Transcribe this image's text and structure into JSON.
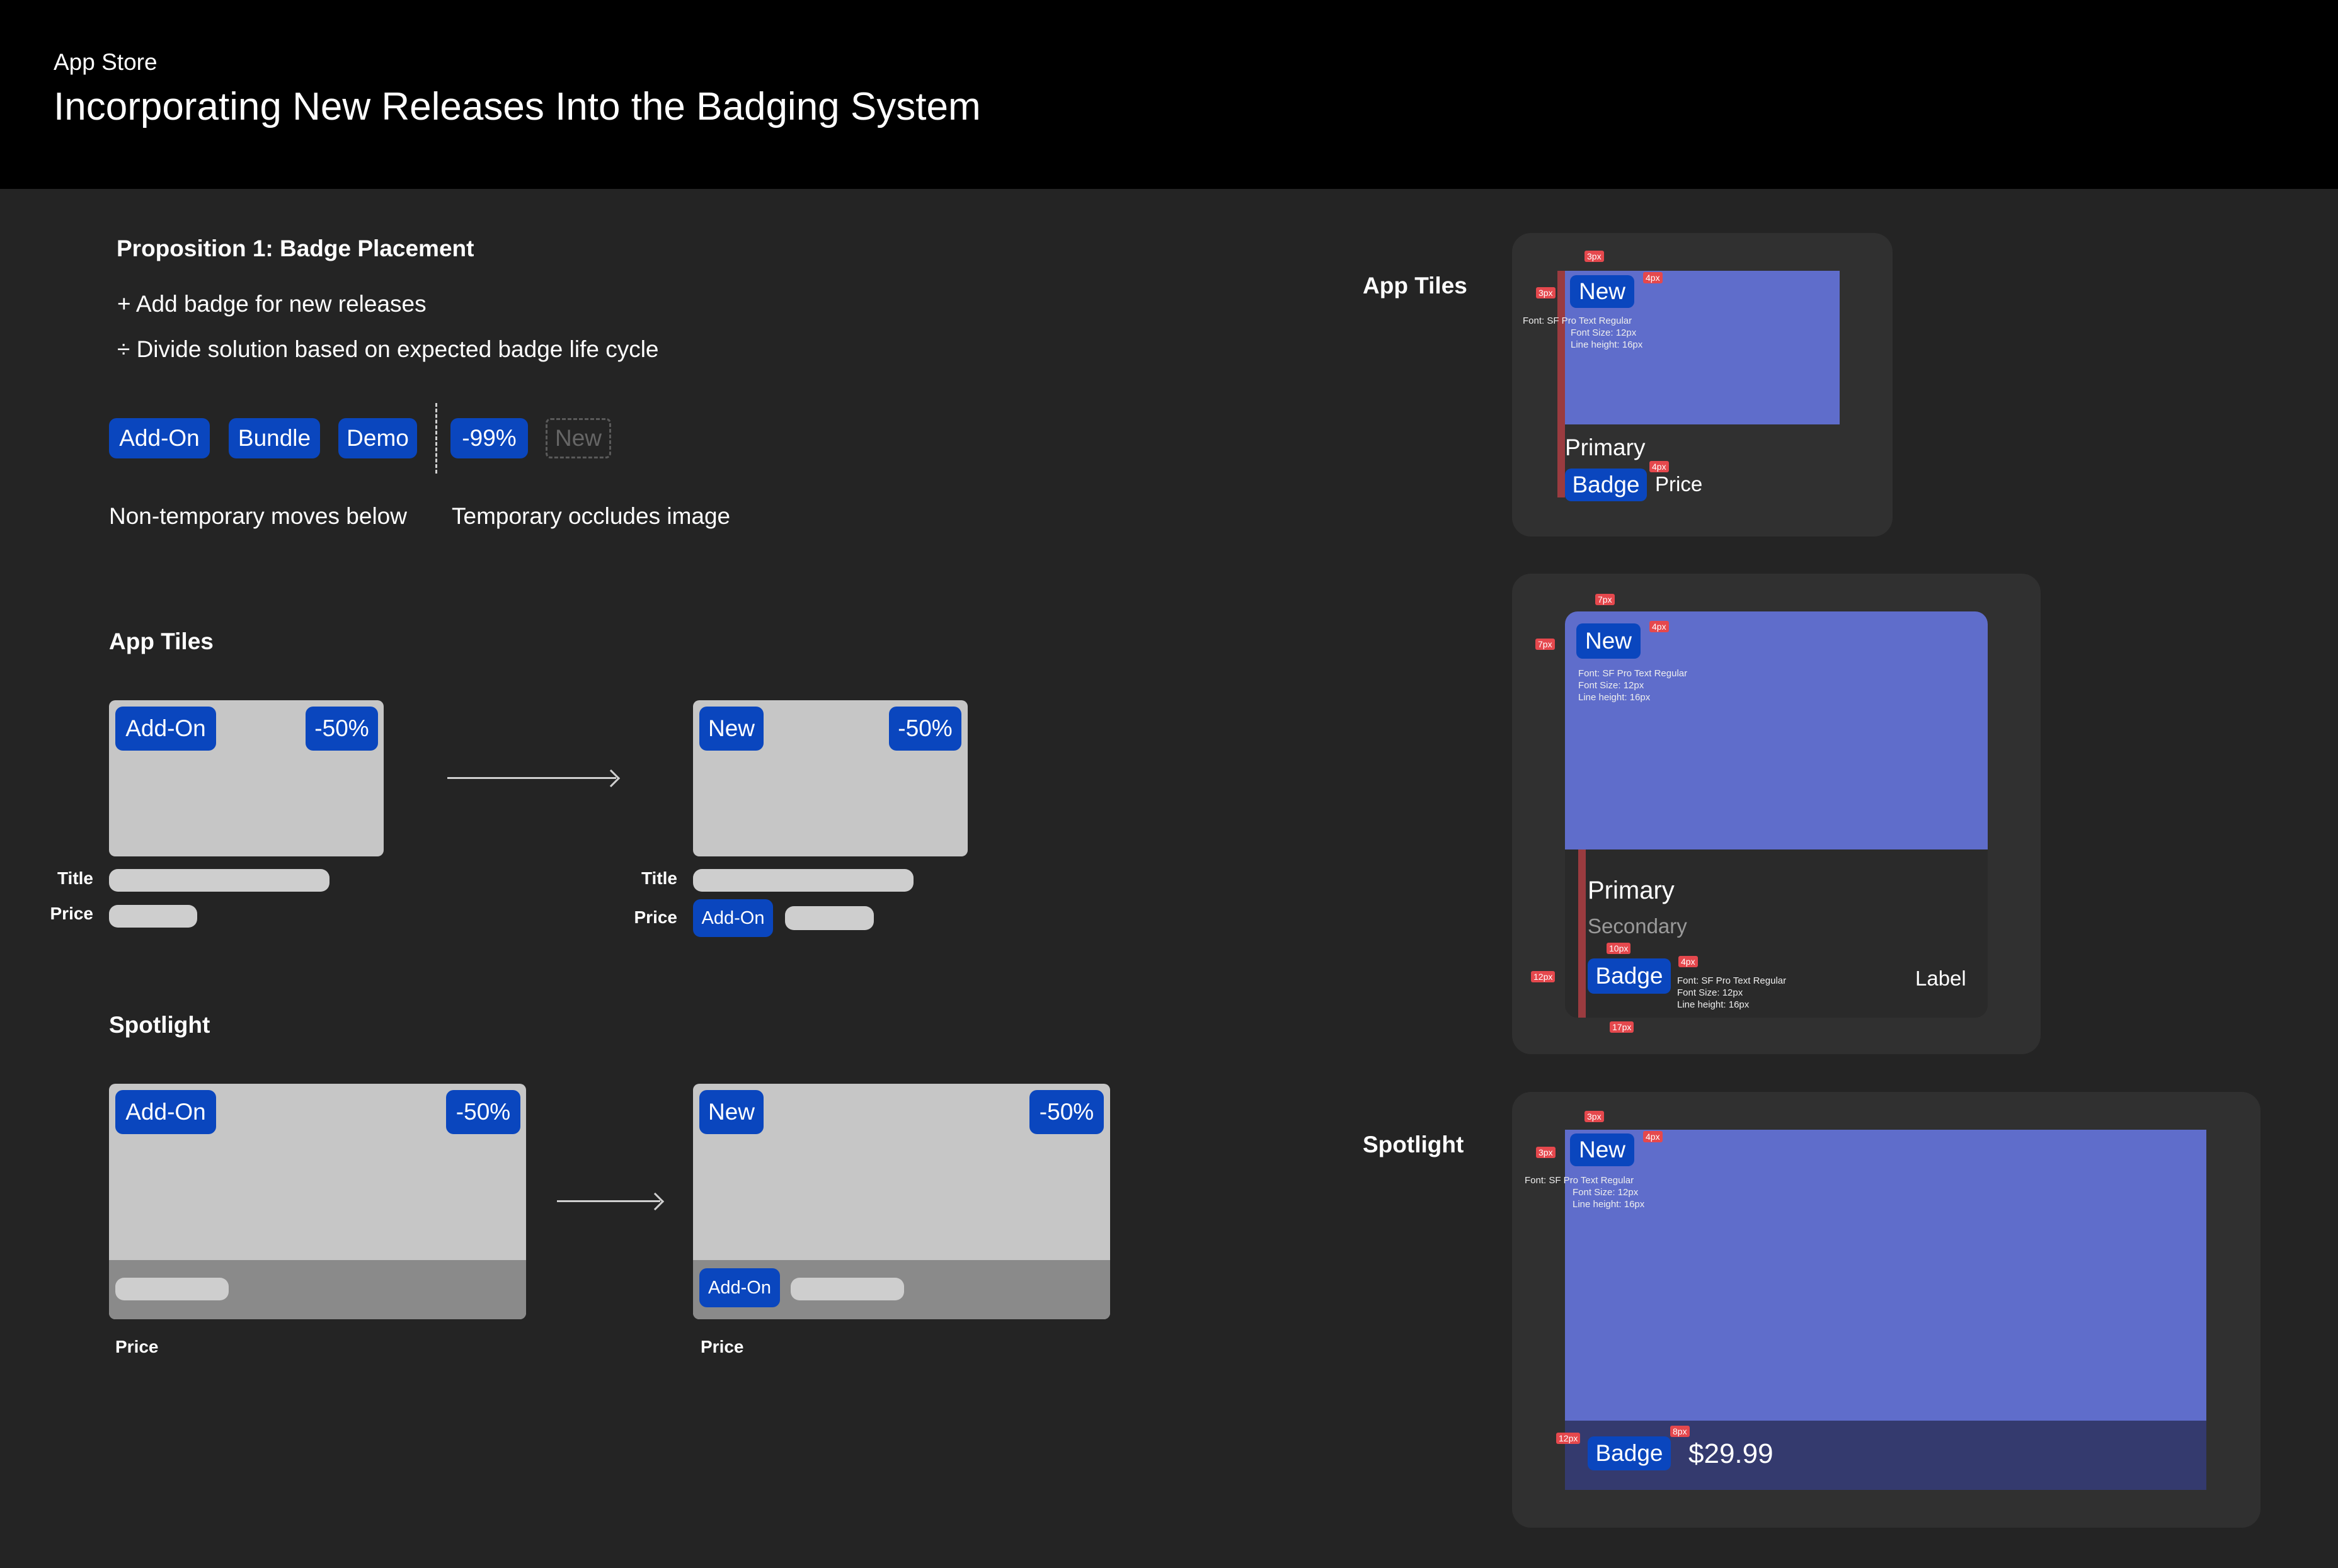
{
  "header": {
    "app_name": "App Store",
    "title": "Incorporating New Releases Into the Badging System"
  },
  "proposition": {
    "title": "Proposition 1: Badge Placement",
    "bullets": [
      "+ Add badge for new releases",
      "÷ Divide solution based on expected badge life cycle"
    ],
    "badges_nontemp": [
      "Add-On",
      "Bundle",
      "Demo"
    ],
    "badges_temp": [
      "-99%",
      "New"
    ],
    "caption_nontemp": "Non-temporary moves below",
    "caption_temp": "Temporary occludes image"
  },
  "app_tiles": {
    "heading": "App Tiles",
    "before": {
      "badge_left": "Add-On",
      "badge_right": "-50%",
      "title_label": "Title",
      "price_label": "Price"
    },
    "after": {
      "badge_left": "New",
      "badge_right": "-50%",
      "title_label": "Title",
      "price_label": "Price",
      "price_badge": "Add-On"
    }
  },
  "spotlight": {
    "heading": "Spotlight",
    "before": {
      "badge_left": "Add-On",
      "badge_right": "-50%",
      "price_label": "Price"
    },
    "after": {
      "badge_left": "New",
      "badge_right": "-50%",
      "price_label": "Price",
      "price_badge": "Add-On"
    }
  },
  "specs": {
    "app_tiles_heading": "App Tiles",
    "spotlight_heading": "Spotlight",
    "font_spec": [
      "Font: SF Pro Text Regular",
      "Font Size: 12px",
      "Line height: 16px"
    ],
    "tile_small": {
      "badge": "New",
      "primary": "Primary",
      "price_badge": "Badge",
      "price": "Price",
      "tags": [
        "3px",
        "3px",
        "4px",
        "4px"
      ]
    },
    "tile_large": {
      "badge": "New",
      "primary": "Primary",
      "secondary": "Secondary",
      "price_badge": "Badge",
      "label": "Label",
      "tags": [
        "7px",
        "7px",
        "4px",
        "10px",
        "4px",
        "12px",
        "17px"
      ]
    },
    "spotlight": {
      "badge": "New",
      "price_badge": "Badge",
      "price": "$29.99",
      "tags": [
        "3px",
        "3px",
        "4px",
        "12px",
        "8px"
      ]
    }
  },
  "colors": {
    "badge_blue": "#0A46BE",
    "spec_purple": "#5F6DCB",
    "spec_tag_red": "#E5484D",
    "background": "#242424",
    "header": "#000000"
  }
}
